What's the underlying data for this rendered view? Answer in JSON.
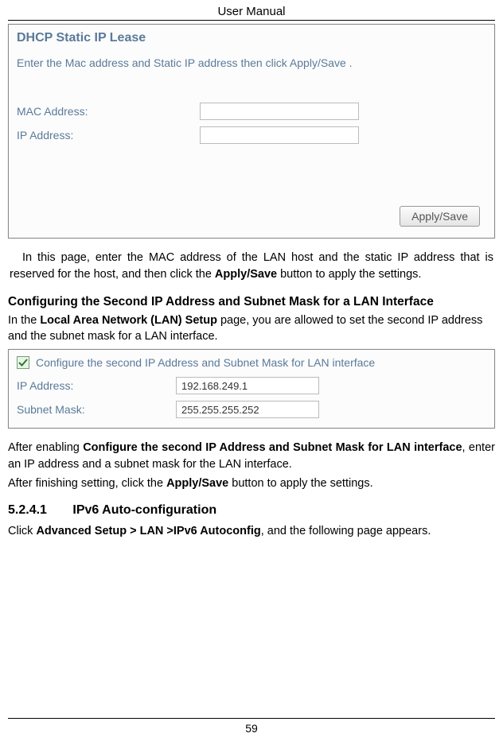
{
  "header": {
    "title": "User Manual"
  },
  "shot1": {
    "title": "DHCP Static IP Lease",
    "desc": "Enter the Mac address and Static IP address then click Apply/Save .",
    "mac_label": "MAC Address:",
    "ip_label": "IP Address:",
    "mac_value": "",
    "ip_value": "",
    "apply_btn": "Apply/Save"
  },
  "para1": {
    "text_before": "In this page, enter the MAC address of the LAN host and the static IP address that is reserved for the host, and then click the ",
    "bold": "Apply/Save",
    "text_after": " button to apply the settings."
  },
  "heading1": "Configuring the Second IP Address and Subnet Mask for a LAN Interface",
  "para2": {
    "text_before": "In the ",
    "bold": "Local Area Network (LAN) Setup",
    "text_after": " page, you are allowed to set the second IP address and the subnet mask for a LAN interface."
  },
  "shot2": {
    "checkbox_label": "Configure the second IP Address and Subnet Mask for LAN interface",
    "ip_label": "IP Address:",
    "subnet_label": "Subnet Mask:",
    "ip_value": "192.168.249.1",
    "subnet_value": "255.255.255.252"
  },
  "para3": {
    "t1": "After enabling ",
    "b1": "Configure the second IP Address and Subnet Mask for LAN interface",
    "t2": ", enter an IP address and a subnet mask for the LAN interface."
  },
  "para4": {
    "t1": "After finishing setting, click the ",
    "b1": "Apply/Save",
    "t2": " button to apply the settings."
  },
  "section": {
    "number": "5.2.4.1",
    "title": "IPv6 Auto-configuration"
  },
  "para5": {
    "t1": "Click ",
    "b1": "Advanced Setup > LAN >IPv6 Autoconfig",
    "t2": ", and the following page appears."
  },
  "page_number": "59"
}
